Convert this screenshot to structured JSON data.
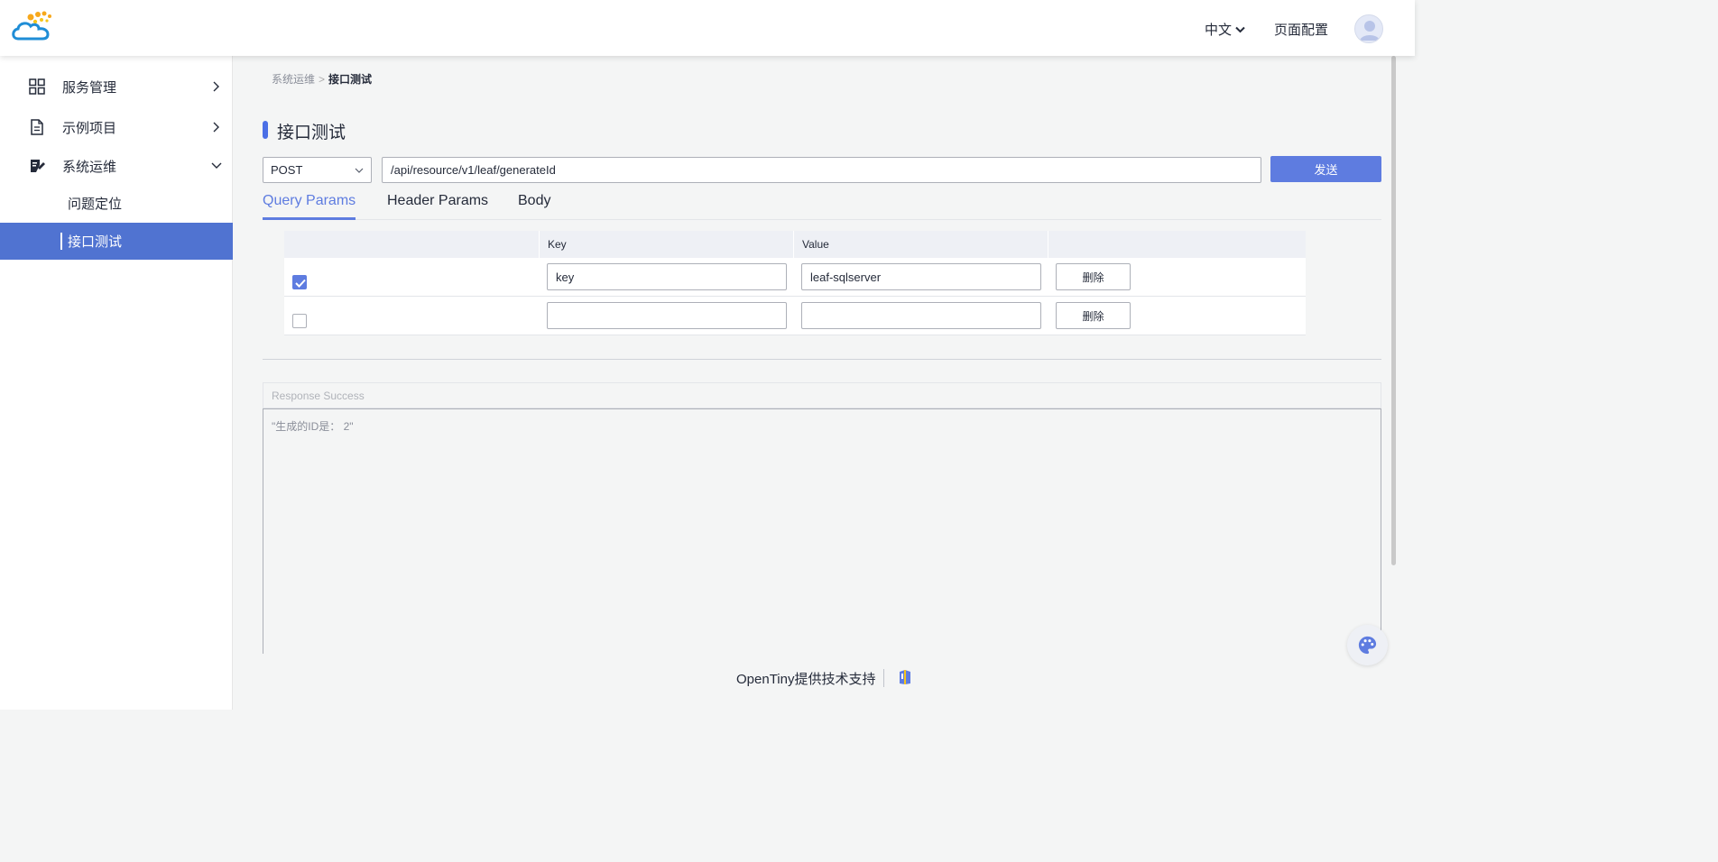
{
  "header": {
    "language": "中文",
    "page_config": "页面配置"
  },
  "sidebar": {
    "items": [
      {
        "label": "服务管理",
        "icon": "grid-icon"
      },
      {
        "label": "示例项目",
        "icon": "document-icon"
      },
      {
        "label": "系统运维",
        "icon": "ops-icon",
        "expanded": true,
        "children": [
          {
            "label": "问题定位"
          },
          {
            "label": "接口测试",
            "active": true
          }
        ]
      }
    ]
  },
  "breadcrumb": {
    "parent": "系统运维",
    "separator": ">",
    "current": "接口测试"
  },
  "page_title": "接口测试",
  "request": {
    "method": "POST",
    "url": "/api/resource/v1/leaf/generateId",
    "send_label": "发送"
  },
  "tabs": [
    {
      "label": "Query Params",
      "active": true
    },
    {
      "label": "Header Params"
    },
    {
      "label": "Body"
    }
  ],
  "params": {
    "headers": {
      "key": "Key",
      "value": "Value"
    },
    "rows": [
      {
        "checked": true,
        "key": "key",
        "value": "leaf-sqlserver",
        "delete_label": "删除"
      },
      {
        "checked": false,
        "key": "",
        "value": "",
        "delete_label": "删除"
      }
    ]
  },
  "response": {
    "status": "Response Success",
    "body": "\"生成的ID是： 2\""
  },
  "footer": {
    "text": "OpenTiny提供技术支持"
  },
  "colors": {
    "accent": "#5e7ce0",
    "active_menu": "#5073d1",
    "background": "#f4f5f5"
  }
}
